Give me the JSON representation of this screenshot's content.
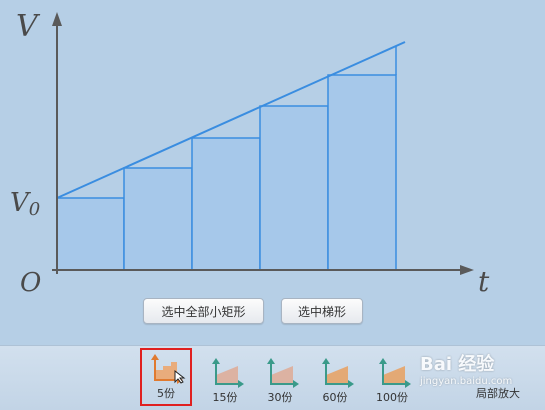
{
  "colors": {
    "background": "#b6cfe6",
    "axis": "#5a5a5a",
    "line": "#3a8de0",
    "rect_fill": "#a6c8ea",
    "icon_arrow": "#3a9a8a",
    "icon_selected": "#e07a30",
    "selection_border": "#e02020"
  },
  "graph": {
    "y_axis_label": "V",
    "y_intercept_label": "V0",
    "origin_label": "O",
    "x_axis_label": "t"
  },
  "buttons": {
    "select_all_rects": "选中全部小矩形",
    "select_trapezoid": "选中梯形"
  },
  "toolbar": {
    "tools": [
      {
        "label": "5份",
        "selected": true
      },
      {
        "label": "15份",
        "selected": false
      },
      {
        "label": "30份",
        "selected": false
      },
      {
        "label": "60份",
        "selected": false
      },
      {
        "label": "100份",
        "selected": false
      }
    ],
    "zoom_label": "局部放大"
  },
  "watermark": {
    "main": "Bai 经验",
    "sub": "jingyan.baidu.com"
  }
}
